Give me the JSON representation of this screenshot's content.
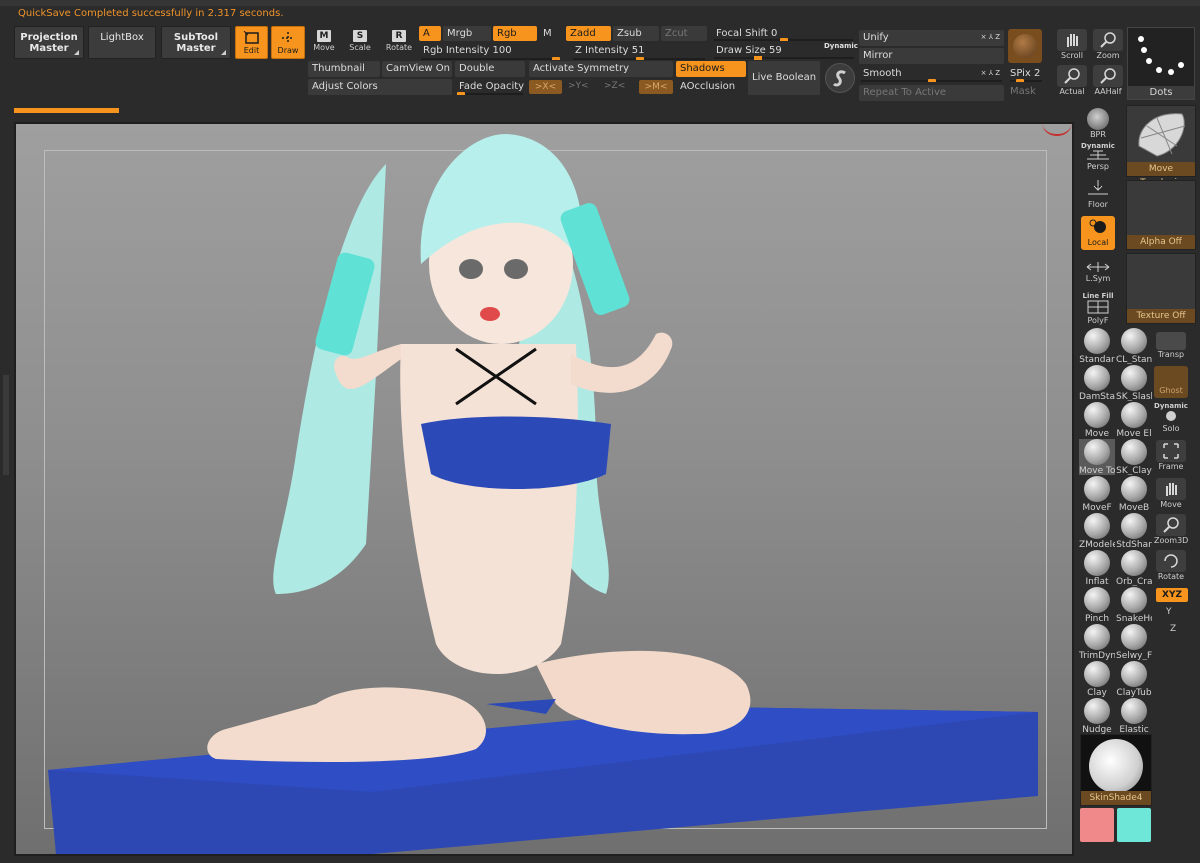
{
  "status_message": "QuickSave Completed successfully in 2.317 seconds.",
  "menu": {
    "projection_master": [
      "Projection",
      "Master"
    ],
    "lightbox": "LightBox",
    "subtool_master": [
      "SubTool",
      "Master"
    ]
  },
  "tools": {
    "edit": "Edit",
    "draw": "Draw",
    "move": {
      "key": "M",
      "label": "Move"
    },
    "scale": {
      "key": "S",
      "label": "Scale"
    },
    "rotate": {
      "key": "R",
      "label": "Rotate"
    }
  },
  "color_modes": {
    "a": "A",
    "mrgb": "Mrgb",
    "rgb": "Rgb",
    "m": "M"
  },
  "sculpt_modes": {
    "zadd": "Zadd",
    "zsub": "Zsub",
    "zcut": "Zcut"
  },
  "sliders": {
    "rgb_intensity": {
      "label": "Rgb Intensity",
      "value": "100",
      "fraction": 1.0
    },
    "z_intensity": {
      "label": "Z Intensity",
      "value": "51",
      "fraction": 0.51
    },
    "focal_shift": {
      "label": "Focal Shift",
      "value": "0",
      "fraction": 0.5
    },
    "draw_size": {
      "label": "Draw Size",
      "value": "59",
      "fraction": 0.3
    },
    "fade_opacity": {
      "label": "Fade Opacity",
      "value": "0",
      "fraction": 0.0
    },
    "smooth": {
      "label": "Smooth",
      "fraction": 0.5
    },
    "spix": {
      "label": "SPix",
      "value": "2"
    }
  },
  "dynamic_label": "Dynamic",
  "row2": {
    "thumbnail": "Thumbnail",
    "camview": "CamView On",
    "double": "Double",
    "activate_symmetry": "Activate Symmetry",
    "shadows": "Shadows",
    "live_boolean": "Live Boolean",
    "adjust_colors": "Adjust Colors",
    "x_axis": ">X<",
    "y_axis": ">Y<",
    "z_axis": ">Z<",
    "m_axis": ">M<",
    "aocclusion": "AOcclusion"
  },
  "right_panel": {
    "unify": "Unify",
    "mirror": "Mirror",
    "repeat_to_active": "Repeat To Active",
    "mask": "Mask",
    "xyz_icons": "× ⅄ Z"
  },
  "nav": {
    "scroll": "Scroll",
    "zoom": "Zoom",
    "actual": "Actual",
    "aahalf": "AAHalf",
    "dots": "Dots"
  },
  "side_buttons": {
    "bpr": "BPR",
    "persp": "Persp",
    "persp_top": "Dynamic",
    "floor": "Floor",
    "local": "Local",
    "lsym": "L.Sym",
    "polyf": "PolyF",
    "polyf_top": "Line Fill",
    "transp": "Transp",
    "ghost": "Ghost",
    "solo": "Solo",
    "solo_top": "Dynamic",
    "frame": "Frame",
    "move": "Move",
    "zoom3d": "Zoom3D",
    "rotate": "Rotate",
    "xyz": "XYZ",
    "y": "Y",
    "z": "Z"
  },
  "thumbnails": {
    "move_topologic": "Move Topologic",
    "alpha_off": "Alpha Off",
    "texture_off": "Texture Off",
    "skinshade": "SkinShade4"
  },
  "brushes": [
    "Standar",
    "CL_Stan",
    "DamSta",
    "SK_Slash",
    "Move",
    "Move El",
    "Move To",
    "SK_Clay",
    "MoveF",
    "MoveB",
    "ZModele",
    "StdShar",
    "Inflat",
    "Orb_Cra",
    "Pinch",
    "SnakeHo",
    "TrimDyn",
    "Selwy_F",
    "Clay",
    "ClayTub",
    "Nudge",
    "Elastic"
  ],
  "colors": {
    "accent": "#f7941d",
    "main_color": "#f08a8a",
    "secondary_color": "#6ee6d8",
    "hair": "#b6efeb",
    "bikini": "#2c49b8",
    "mat": "#2d47b3",
    "popsicle": "#5fe2d5"
  }
}
